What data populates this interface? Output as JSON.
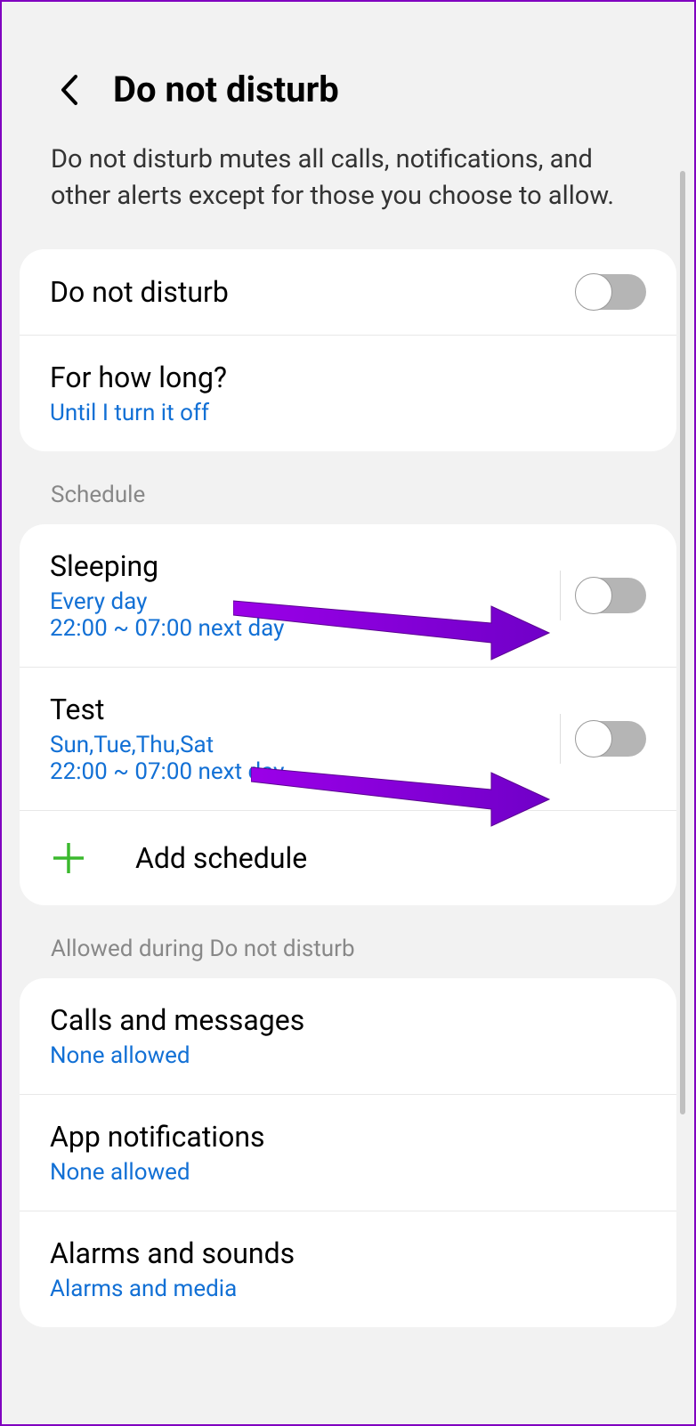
{
  "header": {
    "title": "Do not disturb"
  },
  "description": "Do not disturb mutes all calls, notifications, and other alerts except for those you choose to allow.",
  "settings": {
    "dnd_toggle_label": "Do not disturb",
    "duration_label": "For how long?",
    "duration_value": "Until I turn it off"
  },
  "sections": {
    "schedule": "Schedule",
    "allowed": "Allowed during Do not disturb"
  },
  "schedules": [
    {
      "name": "Sleeping",
      "days": "Every day",
      "time": "22:00 ~ 07:00 next day"
    },
    {
      "name": "Test",
      "days": "Sun,Tue,Thu,Sat",
      "time": "22:00 ~ 07:00 next day"
    }
  ],
  "add_schedule": "Add schedule",
  "allowed_items": {
    "calls_label": "Calls and messages",
    "calls_value": "None allowed",
    "apps_label": "App notifications",
    "apps_value": "None allowed",
    "alarms_label": "Alarms and sounds",
    "alarms_value": "Alarms and media"
  },
  "colors": {
    "link": "#1270d5",
    "plus": "#3bb92e",
    "annotation": "#9b00e8"
  }
}
